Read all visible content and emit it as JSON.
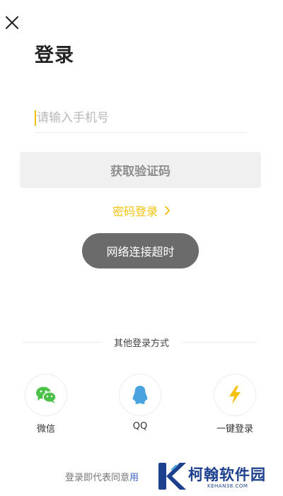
{
  "header": {
    "title": "登录",
    "close_icon": "close-icon"
  },
  "phone": {
    "placeholder": "请输入手机号",
    "value": ""
  },
  "buttons": {
    "get_code": "获取验证码",
    "password_login": "密码登录"
  },
  "toast": {
    "message": "网络连接超时"
  },
  "other_login": {
    "title": "其他登录方式",
    "options": [
      {
        "label": "微信",
        "icon": "wechat-icon",
        "color": "#4cc14a"
      },
      {
        "label": "QQ",
        "icon": "qq-icon",
        "color": "#4aa3df"
      },
      {
        "label": "一键登录",
        "icon": "lightning-icon",
        "color": "#f4c20d"
      }
    ]
  },
  "agreement": {
    "prefix": "登录即代表同意",
    "link_fragment": "用"
  },
  "watermark": {
    "name": "柯翰软件园",
    "domain": "KEHAN38.COM"
  },
  "colors": {
    "accent": "#f4c20d",
    "toast_bg": "#6b6b6b",
    "button_bg": "#f0f0f0",
    "watermark_blue": "#1c3f8e"
  }
}
